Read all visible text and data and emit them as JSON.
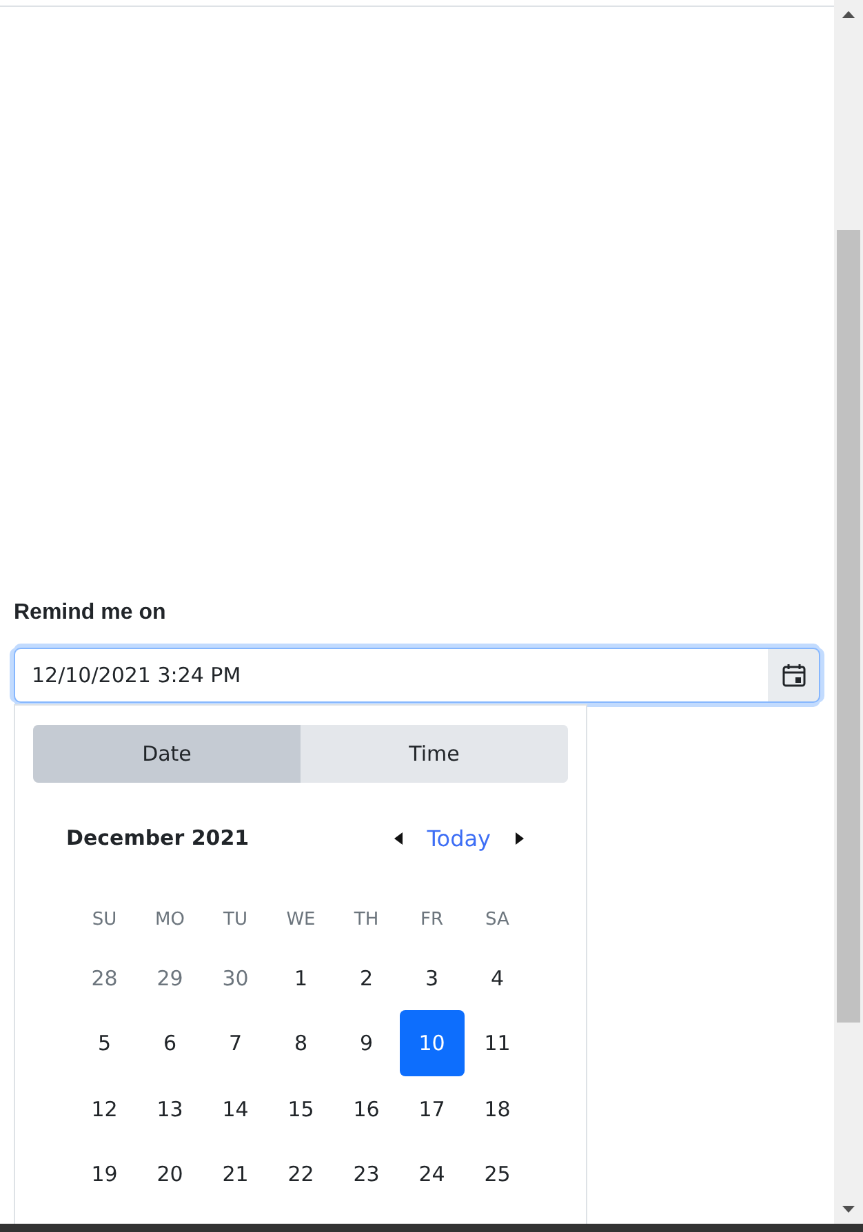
{
  "form": {
    "label": "Remind me on",
    "field": {
      "value": "12/10/2021 3:24 PM",
      "focused": true
    }
  },
  "picker": {
    "tabs": [
      {
        "label": "Date",
        "selected": true
      },
      {
        "label": "Time",
        "selected": false
      }
    ],
    "month": "December 2021",
    "today": "Today",
    "weekdays": [
      "SU",
      "MO",
      "TU",
      "WE",
      "TH",
      "FR",
      "SA"
    ],
    "weeks": [
      [
        {
          "label": "28",
          "muted": true,
          "selected": false
        },
        {
          "label": "29",
          "muted": true,
          "selected": false
        },
        {
          "label": "30",
          "muted": true,
          "selected": false
        },
        {
          "label": "1",
          "muted": false,
          "selected": false
        },
        {
          "label": "2",
          "muted": false,
          "selected": false
        },
        {
          "label": "3",
          "muted": false,
          "selected": false
        },
        {
          "label": "4",
          "muted": false,
          "selected": false
        }
      ],
      [
        {
          "label": "5",
          "muted": false,
          "selected": false
        },
        {
          "label": "6",
          "muted": false,
          "selected": false
        },
        {
          "label": "7",
          "muted": false,
          "selected": false
        },
        {
          "label": "8",
          "muted": false,
          "selected": false
        },
        {
          "label": "9",
          "muted": false,
          "selected": false
        },
        {
          "label": "10",
          "muted": false,
          "selected": true
        },
        {
          "label": "11",
          "muted": false,
          "selected": false
        }
      ],
      [
        {
          "label": "12",
          "muted": false,
          "selected": false
        },
        {
          "label": "13",
          "muted": false,
          "selected": false
        },
        {
          "label": "14",
          "muted": false,
          "selected": false
        },
        {
          "label": "15",
          "muted": false,
          "selected": false
        },
        {
          "label": "16",
          "muted": false,
          "selected": false
        },
        {
          "label": "17",
          "muted": false,
          "selected": false
        },
        {
          "label": "18",
          "muted": false,
          "selected": false
        }
      ],
      [
        {
          "label": "19",
          "muted": false,
          "selected": false
        },
        {
          "label": "20",
          "muted": false,
          "selected": false
        },
        {
          "label": "21",
          "muted": false,
          "selected": false
        },
        {
          "label": "22",
          "muted": false,
          "selected": false
        },
        {
          "label": "23",
          "muted": false,
          "selected": false
        },
        {
          "label": "24",
          "muted": false,
          "selected": false
        },
        {
          "label": "25",
          "muted": false,
          "selected": false
        }
      ]
    ]
  }
}
